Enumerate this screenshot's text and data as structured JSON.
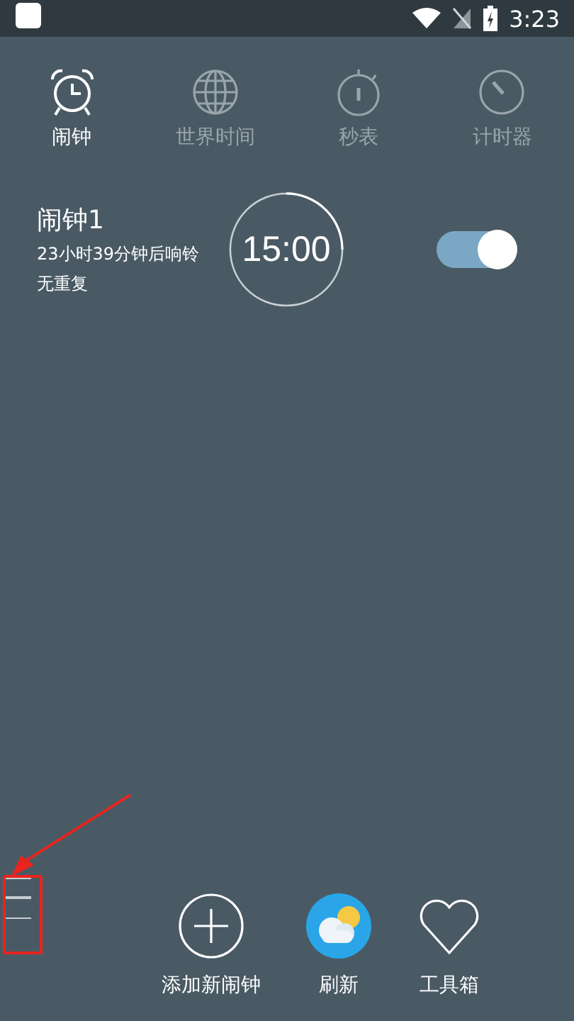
{
  "status_bar": {
    "time": "3:23"
  },
  "tabs": [
    {
      "label": "闹钟",
      "kind": "alarm",
      "selected": true
    },
    {
      "label": "世界时间",
      "kind": "world",
      "selected": false
    },
    {
      "label": "秒表",
      "kind": "stopwatch",
      "selected": false
    },
    {
      "label": "计时器",
      "kind": "timer",
      "selected": false
    }
  ],
  "alarms": [
    {
      "title": "闹钟1",
      "countdown": "23小时39分钟后响铃",
      "repeat": "无重复",
      "time": "15:00",
      "on": true
    }
  ],
  "bottom_actions": [
    {
      "label": "添加新闹钟",
      "kind": "add"
    },
    {
      "label": "刷新",
      "kind": "refresh"
    },
    {
      "label": "工具箱",
      "kind": "toolbox"
    }
  ]
}
